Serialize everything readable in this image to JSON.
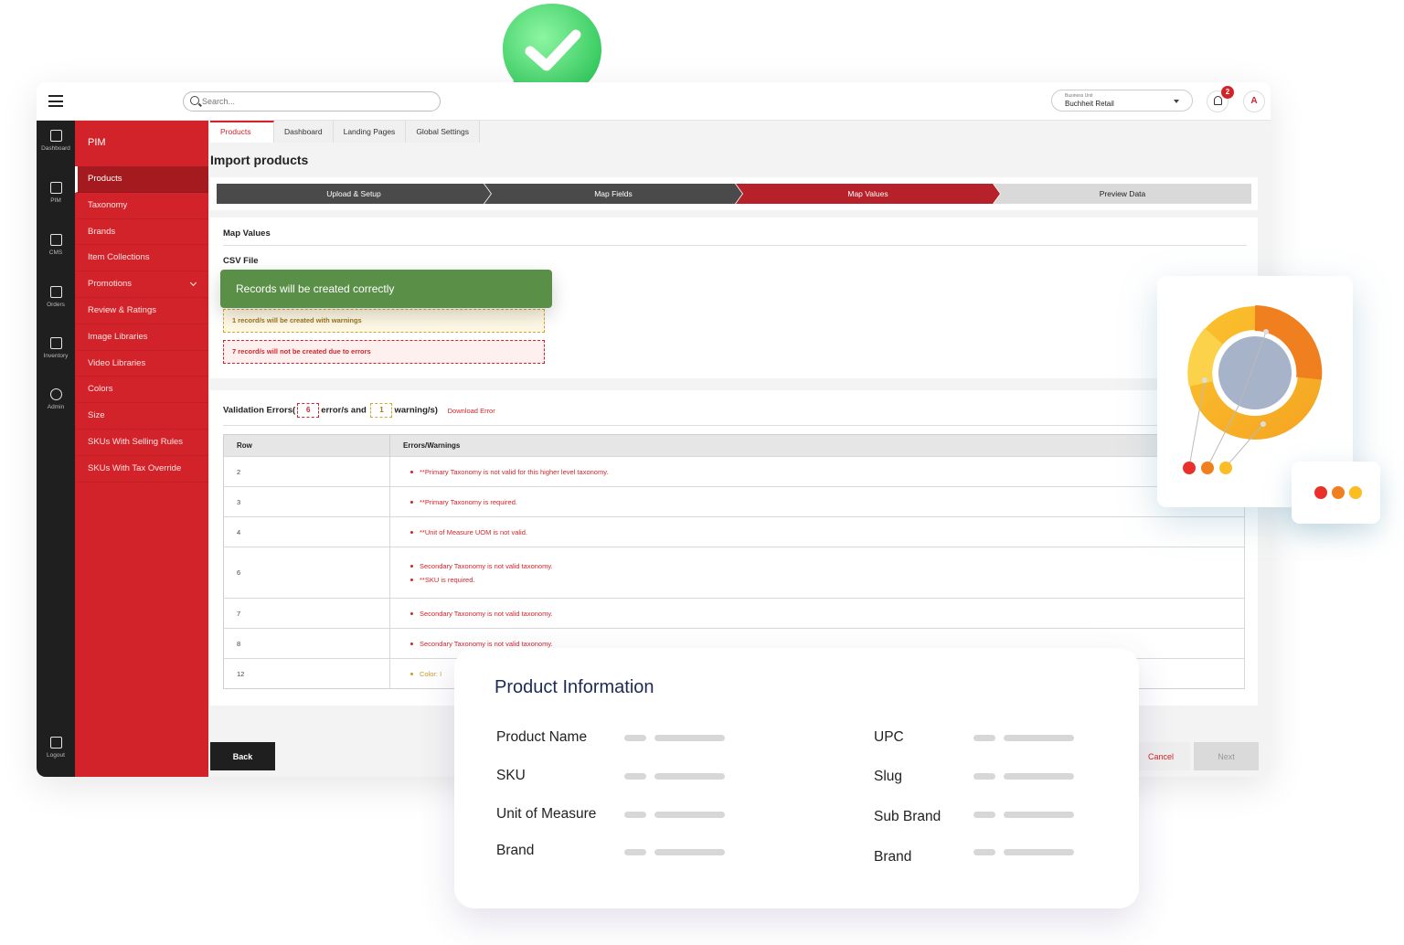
{
  "topbar": {
    "search_placeholder": "Search...",
    "business_unit_label": "Business Unit",
    "business_unit_value": "Buchheit Retail",
    "notification_count": "2",
    "avatar_initial": "A"
  },
  "rail": {
    "items": [
      "Dashboard",
      "PIM",
      "CMS",
      "Orders",
      "Inventory",
      "Admin"
    ],
    "logout": "Logout"
  },
  "sidebar": {
    "title": "PIM",
    "items": [
      "Products",
      "Taxonomy",
      "Brands",
      "Item Collections",
      "Promotions",
      "Review & Ratings",
      "Image Libraries",
      "Video Libraries",
      "Colors",
      "Size",
      "SKUs With Selling Rules",
      "SKUs With Tax Override"
    ],
    "active_item": "Products"
  },
  "tabs": [
    "Products",
    "Dashboard",
    "Landing Pages",
    "Global Settings"
  ],
  "page_title": "Import products",
  "stepper": {
    "steps": [
      "Upload & Setup",
      "Map Fields",
      "Map Values",
      "Preview Data"
    ],
    "active_step": "Map Values"
  },
  "map_values": {
    "heading": "Map Values",
    "csv_label": "CSV File",
    "success_toast": "Records will be created correctly",
    "warning_text": "1 record/s will be created with warnings",
    "error_text": "7 record/s will not be created due to errors"
  },
  "validation": {
    "prefix": "Validation Errors(",
    "error_count": "6",
    "middle": "error/s and",
    "warning_count": "1",
    "suffix": "warning/s)",
    "download": "Download Error",
    "columns": [
      "Row",
      "Errors/Warnings"
    ],
    "rows": [
      {
        "row": "2",
        "messages": [
          "**Primary Taxonomy is not valid for this higher level taxonomy."
        ]
      },
      {
        "row": "3",
        "messages": [
          "**Primary Taxonomy is required."
        ]
      },
      {
        "row": "4",
        "messages": [
          "**Unit of Measure UOM is not valid."
        ]
      },
      {
        "row": "6",
        "messages": [
          "Secondary Taxonomy is not valid taxonomy.",
          "**SKU is required."
        ]
      },
      {
        "row": "7",
        "messages": [
          "Secondary Taxonomy is not valid taxonomy."
        ]
      },
      {
        "row": "8",
        "messages": [
          "Secondary Taxonomy is not valid taxonomy."
        ]
      },
      {
        "row": "12",
        "messages": [
          "Color: I"
        ]
      }
    ]
  },
  "buttons": {
    "back": "Back",
    "cancel": "Cancel",
    "next": "Next"
  },
  "product_info": {
    "title": "Product Information",
    "left_fields": [
      "Product Name",
      "SKU",
      "Unit of Measure",
      "Brand"
    ],
    "right_fields": [
      "UPC",
      "Slug",
      "Sub Brand",
      "Brand"
    ]
  },
  "colors": {
    "brand_red": "#d3232a",
    "step_dark": "#4a4a4a",
    "success_green": "#5a8f47",
    "donut_orange": "#f07f1f",
    "donut_yellow": "#fbbd23"
  }
}
